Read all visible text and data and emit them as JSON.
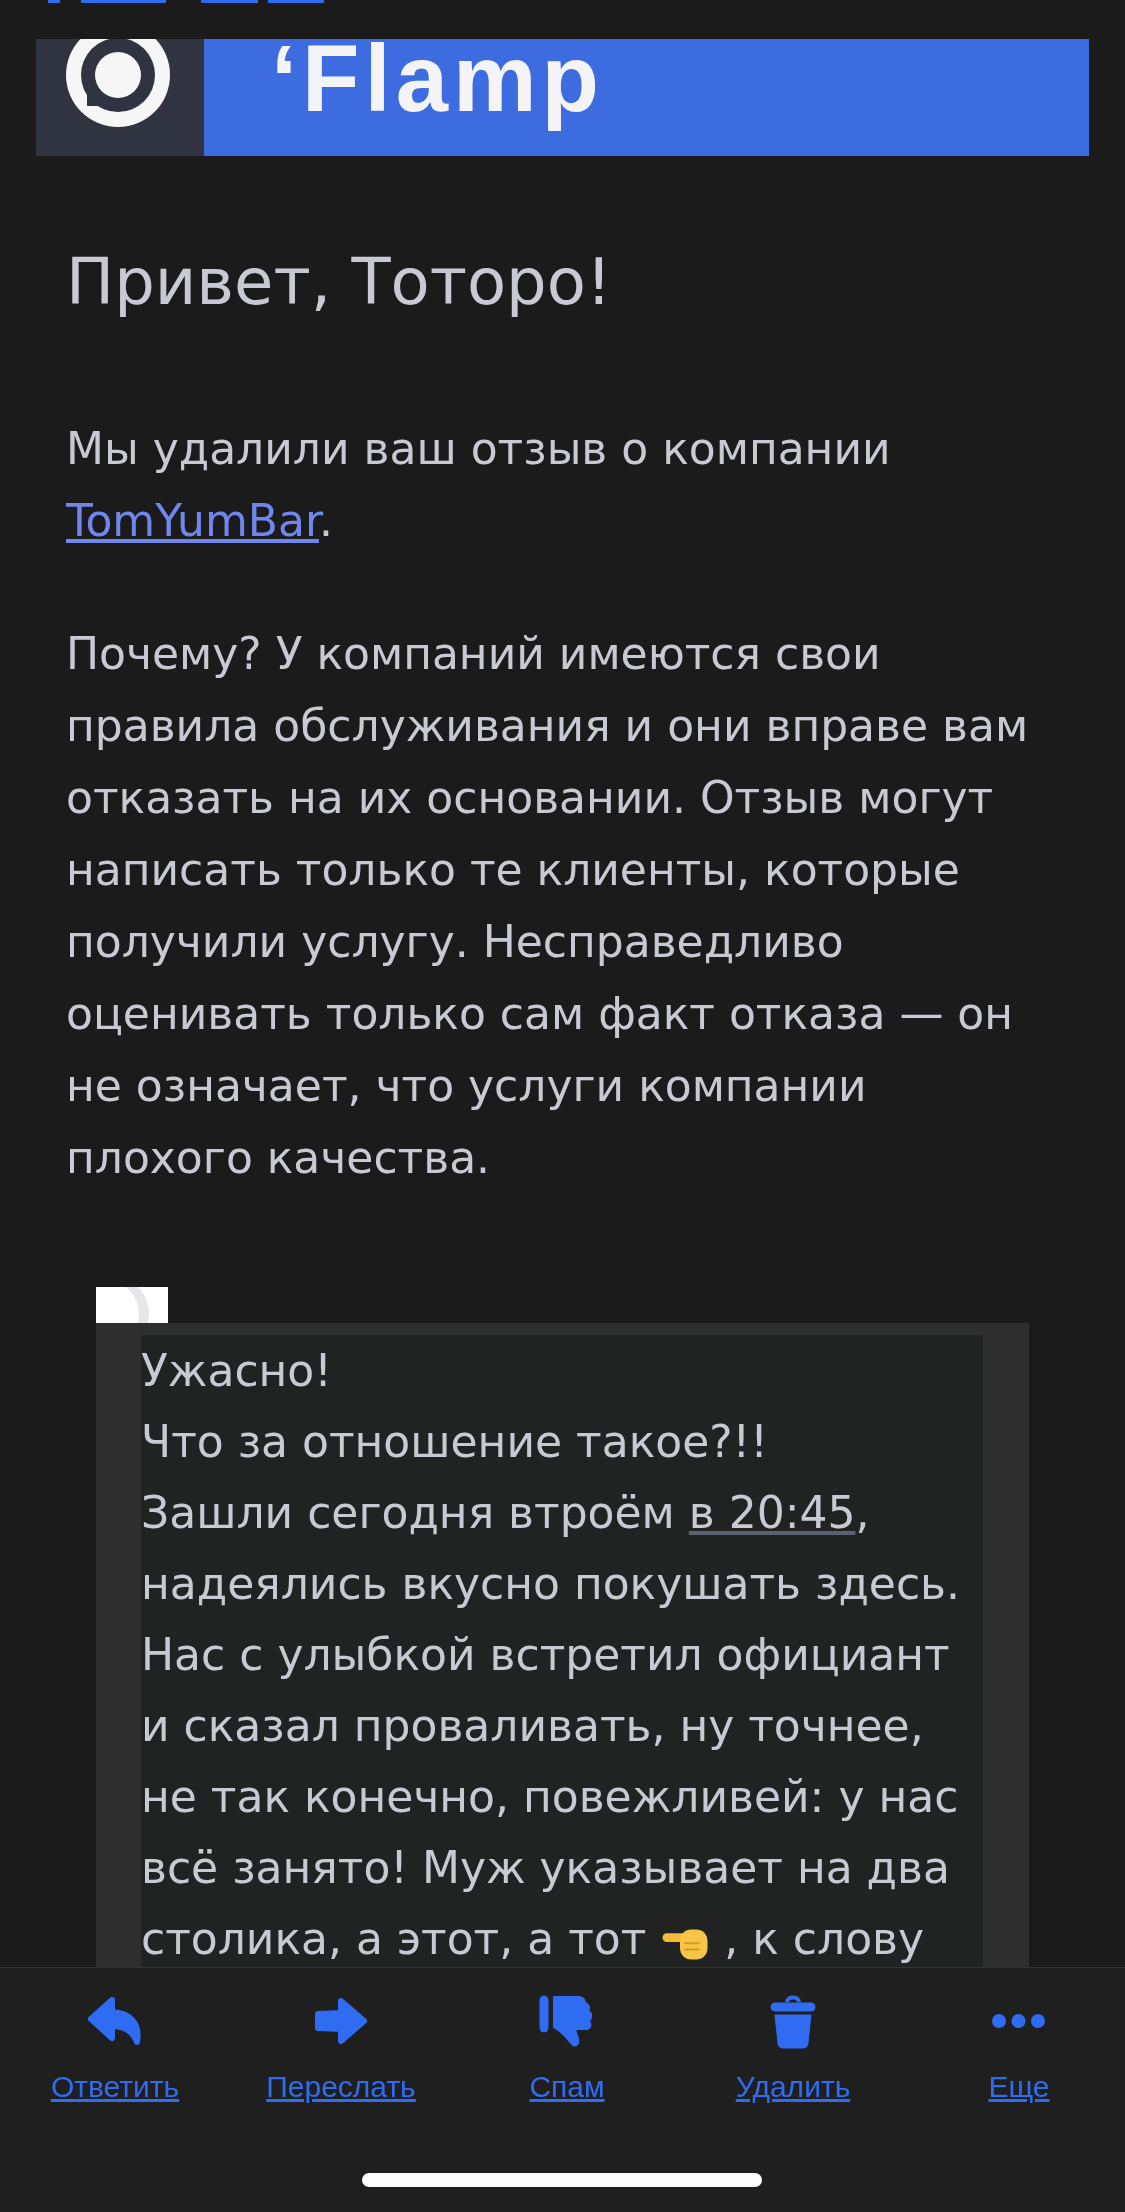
{
  "banner": {
    "logo_text": "‘Flamp"
  },
  "greeting": "Привет, Тоторо!",
  "paragraphs": [
    [
      {
        "kind": "text",
        "text": "Мы удалили ваш отзыв о компании\n"
      },
      {
        "kind": "link",
        "text": "TomYumBar"
      },
      {
        "kind": "text",
        "text": "."
      }
    ],
    [
      {
        "kind": "text",
        "text": "Почему? У компаний имеются свои\nправила обслуживания и они вправе вам\nотказать на их основании. Отзыв могут\nнаписать только те клиенты, которые\nполучили услугу. Несправедливо\nоценивать только сам факт отказа — он\nне означает, что услуги компании\nплохого качества."
      }
    ]
  ],
  "quote": {
    "paragraphs": [
      [
        {
          "kind": "text",
          "text": "Ужасно!"
        }
      ],
      [
        {
          "kind": "text",
          "text": "Что за отношение такое?!!"
        }
      ],
      [
        {
          "kind": "text",
          "text": "Зашли сегодня втроём "
        },
        {
          "kind": "link",
          "text": "в 20:45"
        },
        {
          "kind": "text",
          "text": ",\nнадеялись вкусно покушать здесь.\nНас с улыбкой встретил официант\nи сказал проваливать, ну точнее,\nне так конечно, повежливей: у нас\nвсё занято! Муж указывает на два\nстолика, а этот, а тот "
        },
        {
          "kind": "emoji"
        },
        {
          "kind": "text",
          "text": " , к слову"
        }
      ]
    ]
  },
  "toolbar": [
    {
      "kind": "reply",
      "label": "Ответить"
    },
    {
      "kind": "forward",
      "label": "Переслать"
    },
    {
      "kind": "spam",
      "label": "Спам"
    },
    {
      "kind": "trash",
      "label": "Удалить"
    },
    {
      "kind": "more",
      "label": "Еще"
    }
  ]
}
